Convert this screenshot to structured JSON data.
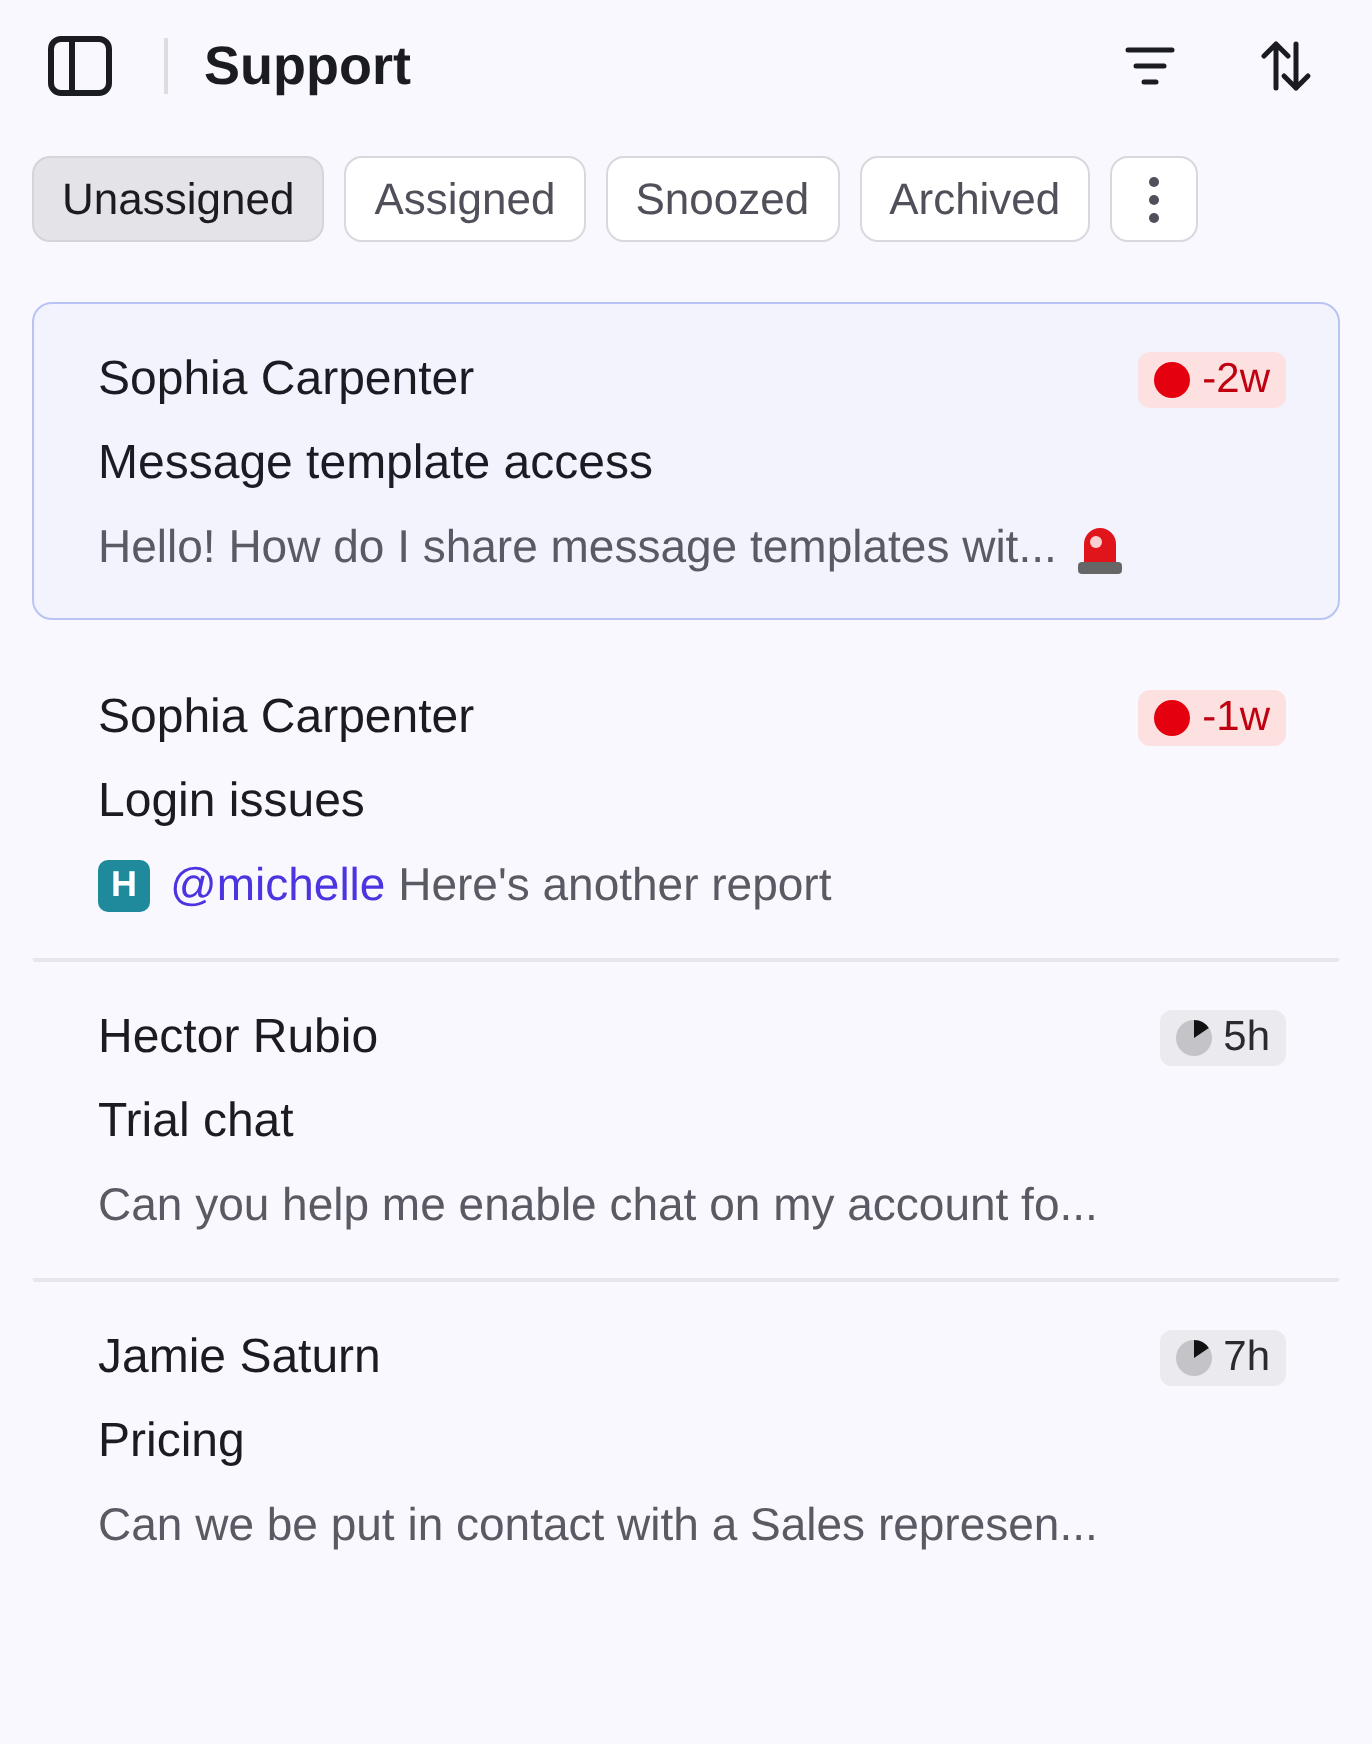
{
  "header": {
    "title": "Support"
  },
  "tabs": [
    {
      "label": "Unassigned",
      "selected": true
    },
    {
      "label": "Assigned",
      "selected": false
    },
    {
      "label": "Snoozed",
      "selected": false
    },
    {
      "label": "Archived",
      "selected": false
    }
  ],
  "conversations": [
    {
      "name": "Sophia Carpenter",
      "subject": "Message template access",
      "selected": true,
      "badge": {
        "kind": "overdue",
        "text": "-2w"
      },
      "preview": "Hello! How do I share message templates wit...",
      "alert": true
    },
    {
      "name": "Sophia Carpenter",
      "subject": "Login issues",
      "selected": false,
      "badge": {
        "kind": "overdue",
        "text": "-1w"
      },
      "avatar": {
        "initial": "H",
        "color": "#1f8a9c"
      },
      "mention": "@michelle",
      "preview": "Here's another report",
      "alert": false
    },
    {
      "name": "Hector Rubio",
      "subject": "Trial chat",
      "selected": false,
      "badge": {
        "kind": "pending",
        "text": "5h"
      },
      "preview": "Can you help me enable chat on my account fo...",
      "alert": false
    },
    {
      "name": "Jamie Saturn",
      "subject": "Pricing",
      "selected": false,
      "badge": {
        "kind": "pending",
        "text": "7h"
      },
      "preview": "Can we be put in contact with a Sales represen...",
      "alert": false
    }
  ]
}
